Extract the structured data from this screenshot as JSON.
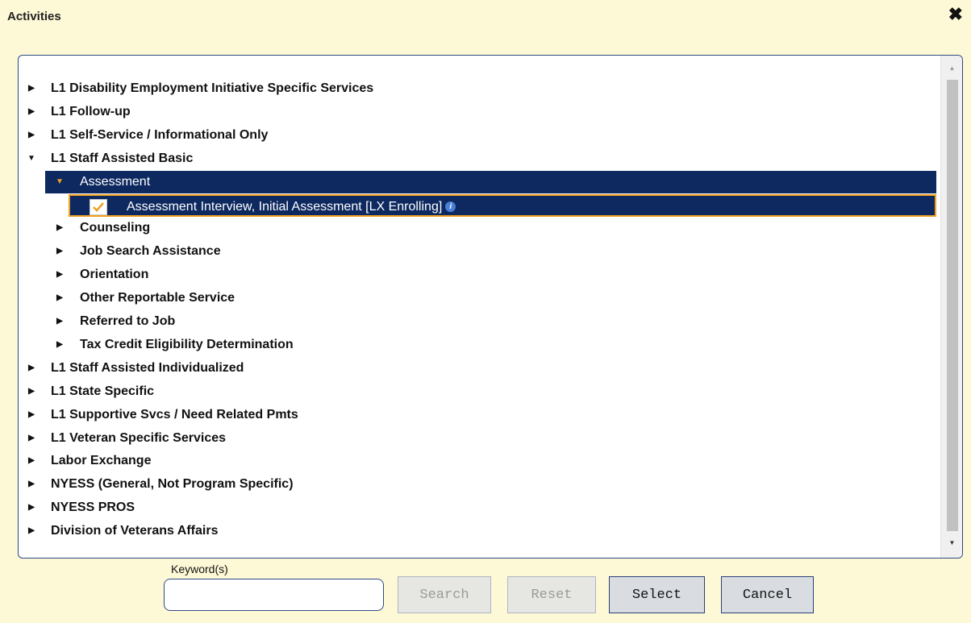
{
  "dialog": {
    "title": "Activities",
    "close_icon": "close-icon"
  },
  "tree": {
    "items": [
      {
        "label": "L1 Disability Employment Initiative Specific Services",
        "level": 0,
        "expanded": false
      },
      {
        "label": "L1 Follow-up",
        "level": 0,
        "expanded": false
      },
      {
        "label": "L1 Self-Service / Informational Only",
        "level": 0,
        "expanded": false
      },
      {
        "label": "L1 Staff Assisted Basic",
        "level": 0,
        "expanded": true
      },
      {
        "label": "Assessment",
        "level": 1,
        "expanded": true,
        "selected": true
      },
      {
        "label": "Assessment Interview, Initial Assessment [LX Enrolling]",
        "level": 2,
        "checked": true,
        "info_icon": "info-icon"
      },
      {
        "label": "Counseling",
        "level": 1,
        "expanded": false
      },
      {
        "label": "Job Search Assistance",
        "level": 1,
        "expanded": false
      },
      {
        "label": "Orientation",
        "level": 1,
        "expanded": false
      },
      {
        "label": "Other Reportable Service",
        "level": 1,
        "expanded": false
      },
      {
        "label": "Referred to Job",
        "level": 1,
        "expanded": false
      },
      {
        "label": "Tax Credit Eligibility Determination",
        "level": 1,
        "expanded": false
      },
      {
        "label": "L1 Staff Assisted Individualized",
        "level": 0,
        "expanded": false
      },
      {
        "label": "L1 State Specific",
        "level": 0,
        "expanded": false
      },
      {
        "label": "L1 Supportive Svcs / Need Related Pmts",
        "level": 0,
        "expanded": false
      },
      {
        "label": "L1 Veteran Specific Services",
        "level": 0,
        "expanded": false
      },
      {
        "label": "Labor Exchange",
        "level": 0,
        "expanded": false
      },
      {
        "label": "NYESS (General, Not Program Specific)",
        "level": 0,
        "expanded": false
      },
      {
        "label": "NYESS PROS",
        "level": 0,
        "expanded": false
      },
      {
        "label": "Division of Veterans Affairs",
        "level": 0,
        "expanded": false
      }
    ]
  },
  "search": {
    "keyword_label": "Keyword(s)",
    "keyword_value": "",
    "search_label": "Search",
    "reset_label": "Reset",
    "select_label": "Select",
    "cancel_label": "Cancel"
  },
  "colors": {
    "background": "#fdf8d6",
    "selection": "#0d2960",
    "accent": "#f0a020",
    "border": "#2f4a85"
  }
}
